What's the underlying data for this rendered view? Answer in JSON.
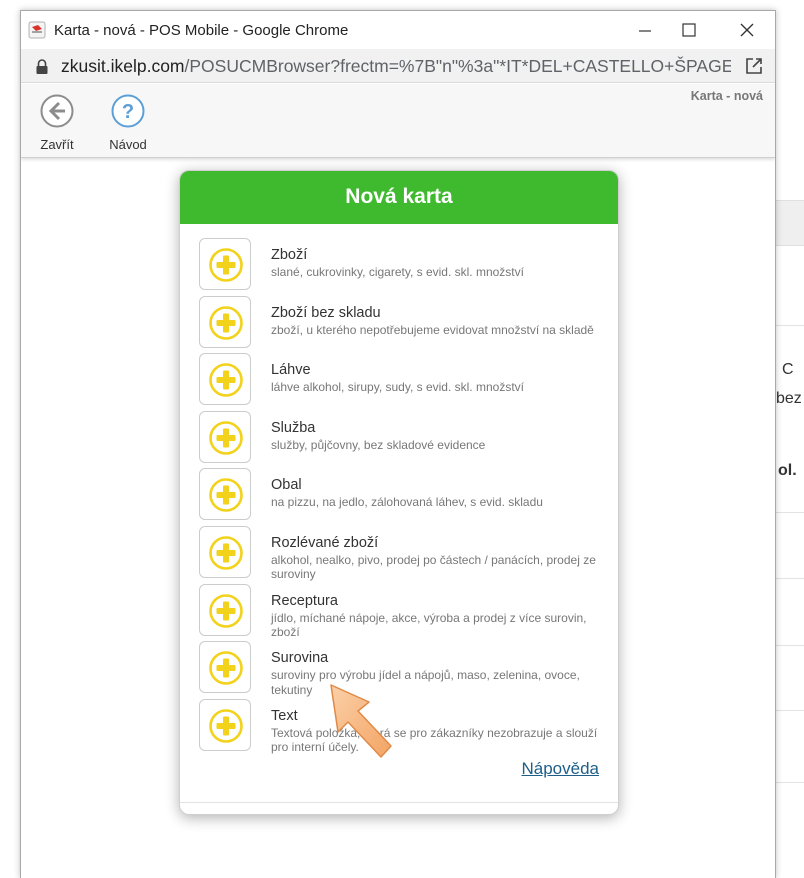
{
  "window": {
    "title": "Karta - nová - POS Mobile - Google Chrome",
    "url_host": "zkusit.ikelp.com",
    "url_rest": "/POSUCMBrowser?frectm=%7B\"n\"%3a\"*IT*DEL+CASTELLO+ŠPAGET..."
  },
  "toolbar": {
    "close_label": "Zavřít",
    "guide_label": "Návod",
    "breadcrumb": "Karta - nová"
  },
  "background": {
    "fragments": [
      "C",
      "bez",
      "ol."
    ]
  },
  "modal": {
    "title": "Nová karta",
    "help_label": "Nápověda",
    "items": [
      {
        "name": "Zboží",
        "desc": "slané, cukrovinky, cigarety, s evid. skl. množství"
      },
      {
        "name": "Zboží bez skladu",
        "desc": "zboží, u kterého nepotřebujeme evidovat množství na skladě"
      },
      {
        "name": "Láhve",
        "desc": "láhve alkohol, sirupy, sudy, s evid. skl. množství"
      },
      {
        "name": "Služba",
        "desc": "služby, půjčovny, bez skladové evidence"
      },
      {
        "name": "Obal",
        "desc": "na pizzu, na jedlo, zálohovaná láhev, s evid. skladu"
      },
      {
        "name": "Rozlévané zboží",
        "desc": "alkohol, nealko, pivo, prodej po částech / panácích, prodej ze suroviny"
      },
      {
        "name": "Receptura",
        "desc": "jídlo, míchané nápoje, akce, výroba a prodej z více surovin, zboží"
      },
      {
        "name": "Surovina",
        "desc": "suroviny pro výrobu jídel a nápojů, maso, zelenina, ovoce, tekutiny"
      },
      {
        "name": "Text",
        "desc": "Textová položka, která se pro zákazníky nezobrazuje a slouží pro interní účely."
      }
    ]
  },
  "colors": {
    "header_green": "#3fba2f",
    "plus_yellow": "#f2d21b",
    "link_blue": "#1d5f8a",
    "arrow_orange": "#f7b27a"
  }
}
